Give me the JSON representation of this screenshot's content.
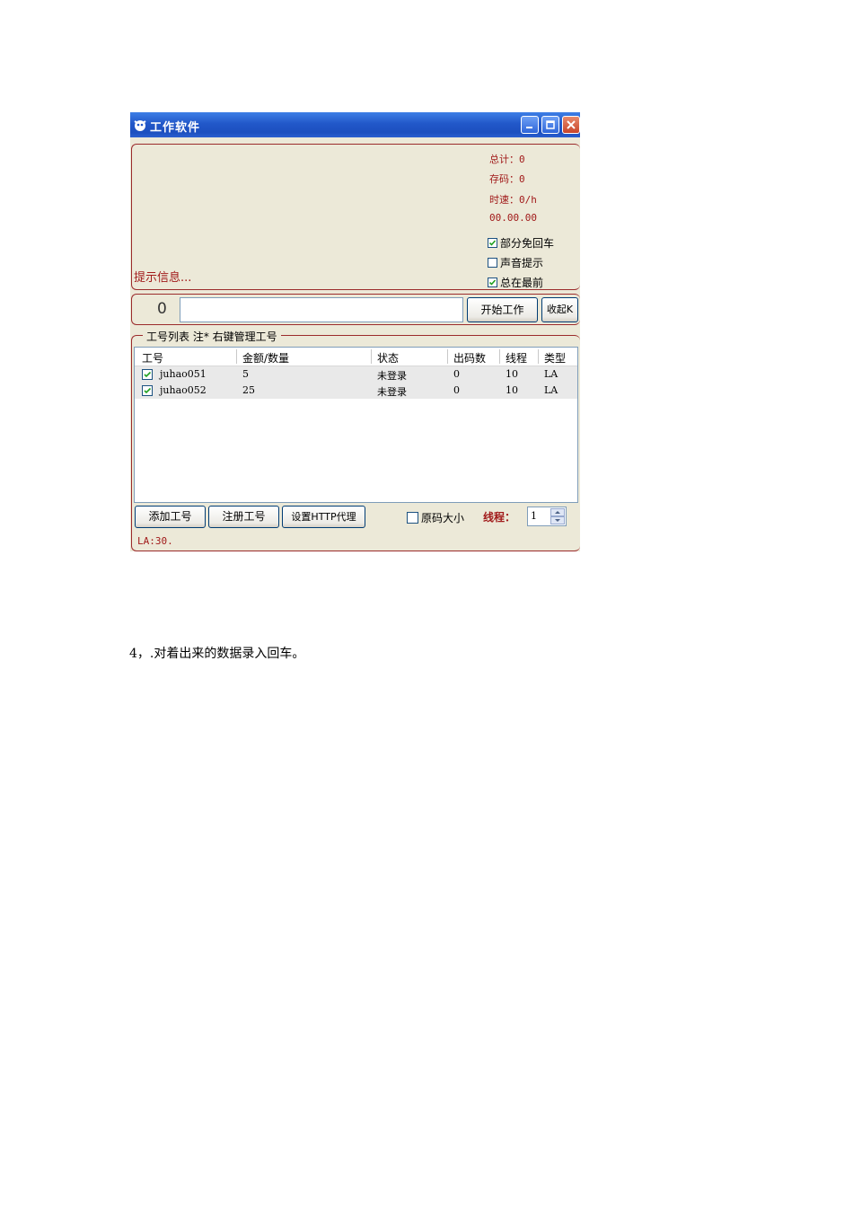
{
  "window": {
    "title": "工作软件",
    "accent": "#2258c9",
    "label_color": "#a11a1a"
  },
  "stats": {
    "total": "总计：0",
    "stored": "存码：0",
    "speed": "时速：0/h",
    "timer": "00.00.00"
  },
  "options": [
    {
      "label": "部分免回车",
      "checked": true
    },
    {
      "label": "声音提示",
      "checked": false
    },
    {
      "label": "总在最前",
      "checked": true
    }
  ],
  "hint": "提示信息...",
  "input_bar": {
    "count": "0",
    "code_value": "",
    "start_label": "开始工作",
    "collapse_label": "收起K"
  },
  "account_list": {
    "title": "工号列表 注* 右键管理工号",
    "columns": [
      "工号",
      "金额/数量",
      "状态",
      "出码数",
      "线程",
      "类型"
    ],
    "rows": [
      {
        "checked": true,
        "id": "juhao051",
        "amount": "5",
        "status": "未登录",
        "codes": "0",
        "threads": "10",
        "type": "LA"
      },
      {
        "checked": true,
        "id": "juhao052",
        "amount": "25",
        "status": "未登录",
        "codes": "0",
        "threads": "10",
        "type": "LA"
      }
    ]
  },
  "bottom": {
    "add_label": "添加工号",
    "register_label": "注册工号",
    "proxy_label": "设置HTTP代理",
    "orig_size_label": "原码大小",
    "orig_size_checked": false,
    "threads_label": "线程：",
    "threads_value": "1",
    "status": "LA:30."
  },
  "document": {
    "step_text": "4，.对着出来的数据录入回车。"
  }
}
